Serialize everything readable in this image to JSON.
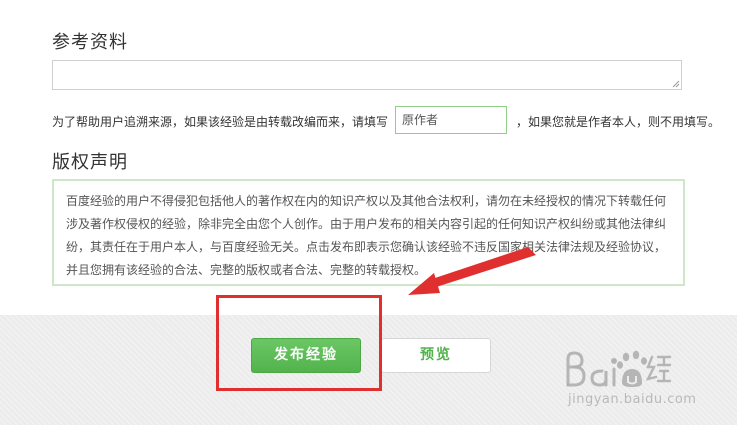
{
  "reference": {
    "heading": "参考资料"
  },
  "source_hint": {
    "text_before": "为了帮助用户追溯来源，如果该经验是由转载改编而来，请填写",
    "author_placeholder": "原作者",
    "text_after": "，如果您就是作者本人，则不用填写。"
  },
  "copyright": {
    "heading": "版权声明",
    "statement": "百度经验的用户不得侵犯包括他人的著作权在内的知识产权以及其他合法权利，请勿在未经授权的情况下转载任何涉及著作权侵权的经验，除非完全由您个人创作。由于用户发布的相关内容引起的任何知识产权纠纷或其他法律纠纷，其责任在于用户本人，与百度经验无关。点击发布即表示您确认该经验不违反国家相关法律法规及经验协议，并且您拥有该经验的合法、完整的版权或者合法、完整的转载授权。"
  },
  "actions": {
    "publish_label": "发布经验",
    "preview_label": "预览"
  },
  "watermark": {
    "url": "jingyan.baidu.com"
  },
  "colors": {
    "primary_green": "#5cb85c",
    "annotation_red": "#e02f2f",
    "box_border": "#cfe7c9"
  }
}
